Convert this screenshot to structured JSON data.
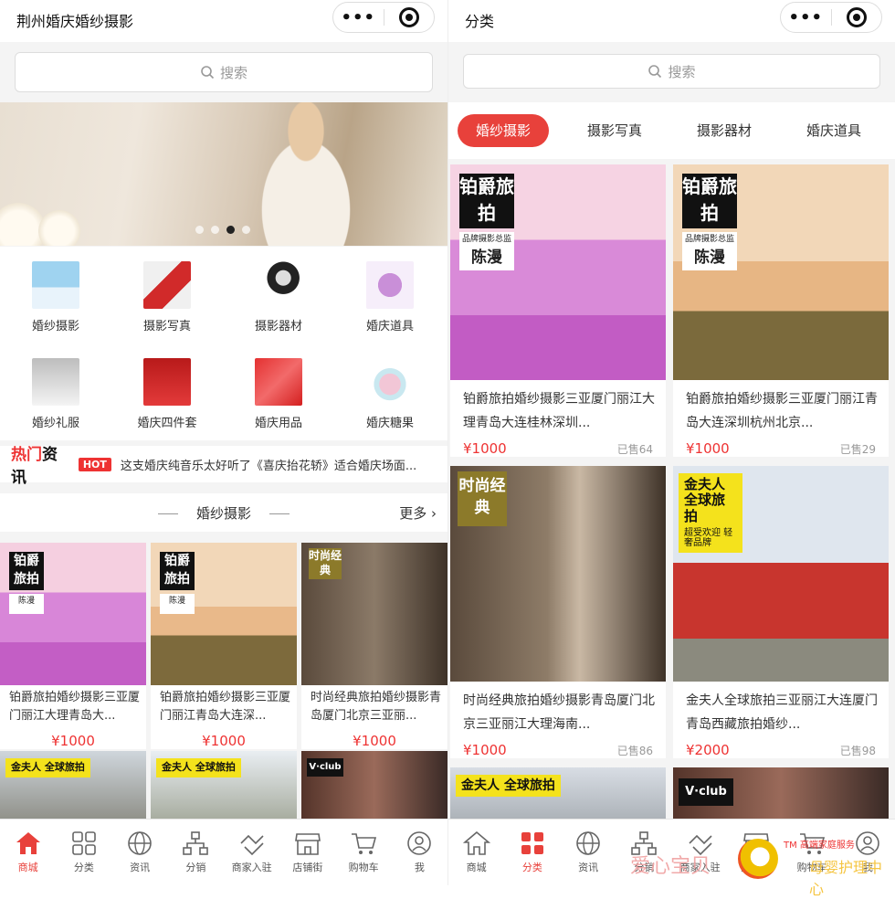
{
  "left": {
    "title": "荆州婚庆婚纱摄影",
    "search_placeholder": "搜索",
    "categories": [
      {
        "label": "婚纱摄影"
      },
      {
        "label": "摄影写真"
      },
      {
        "label": "摄影器材"
      },
      {
        "label": "婚庆道具"
      },
      {
        "label": "婚纱礼服"
      },
      {
        "label": "婚庆四件套"
      },
      {
        "label": "婚庆用品"
      },
      {
        "label": "婚庆糖果"
      }
    ],
    "news": {
      "logo_a": "热门",
      "logo_b": "资讯",
      "badge": "HOT",
      "text": "这支婚庆纯音乐太好听了《喜庆抬花轿》适合婚庆场面..."
    },
    "section": {
      "title": "婚纱摄影",
      "more": "更多"
    },
    "products": [
      {
        "name": "铂爵旅拍婚纱摄影三亚厦门丽江大理青岛大...",
        "price": "¥1000",
        "brand": "铂爵旅拍",
        "brand_sub": "品牌摄影总监",
        "brand_script": "陈漫"
      },
      {
        "name": "铂爵旅拍婚纱摄影三亚厦门丽江青岛大连深...",
        "price": "¥1000",
        "brand": "铂爵旅拍",
        "brand_sub": "品牌摄影总监",
        "brand_script": "陈漫"
      },
      {
        "name": "时尚经典旅拍婚纱摄影青岛厦门北京三亚丽...",
        "price": "¥1000",
        "brand": "时尚经典"
      }
    ],
    "lower_brands": [
      "金夫人 全球旅拍",
      "金夫人 全球旅拍",
      "V·club"
    ]
  },
  "right": {
    "title": "分类",
    "search_placeholder": "搜索",
    "tabs": [
      "婚纱摄影",
      "摄影写真",
      "摄影器材",
      "婚庆道具"
    ],
    "products": [
      {
        "name": "铂爵旅拍婚纱摄影三亚厦门丽江大理青岛大连桂林深圳...",
        "price": "¥1000",
        "sold": "已售64",
        "brand": "铂爵旅拍",
        "brand_sub": "品牌摄影总监",
        "brand_script": "陈漫"
      },
      {
        "name": "铂爵旅拍婚纱摄影三亚厦门丽江青岛大连深圳杭州北京...",
        "price": "¥1000",
        "sold": "已售29",
        "brand": "铂爵旅拍",
        "brand_sub": "品牌摄影总监",
        "brand_script": "陈漫"
      },
      {
        "name": "时尚经典旅拍婚纱摄影青岛厦门北京三亚丽江大理海南...",
        "price": "¥1000",
        "sold": "已售86",
        "brand": "时尚经典"
      },
      {
        "name": "金夫人全球旅拍三亚丽江大连厦门青岛西藏旅拍婚纱...",
        "price": "¥2000",
        "sold": "已售98",
        "brand": "金夫人 全球旅拍",
        "brand_sub": "超受欢迎 轻奢品牌"
      }
    ],
    "lower_brands": [
      "金夫人 全球旅拍",
      "V·club"
    ]
  },
  "tabbar": [
    "商城",
    "分类",
    "资讯",
    "分销",
    "商家入驻",
    "店铺街",
    "购物车",
    "我"
  ],
  "watermark": {
    "text": "爱心宝贝",
    "small": "TM 高端家庭服务",
    "sub": "母婴护理中心"
  },
  "colors": {
    "accent": "#e8413b",
    "price": "#e33333"
  }
}
